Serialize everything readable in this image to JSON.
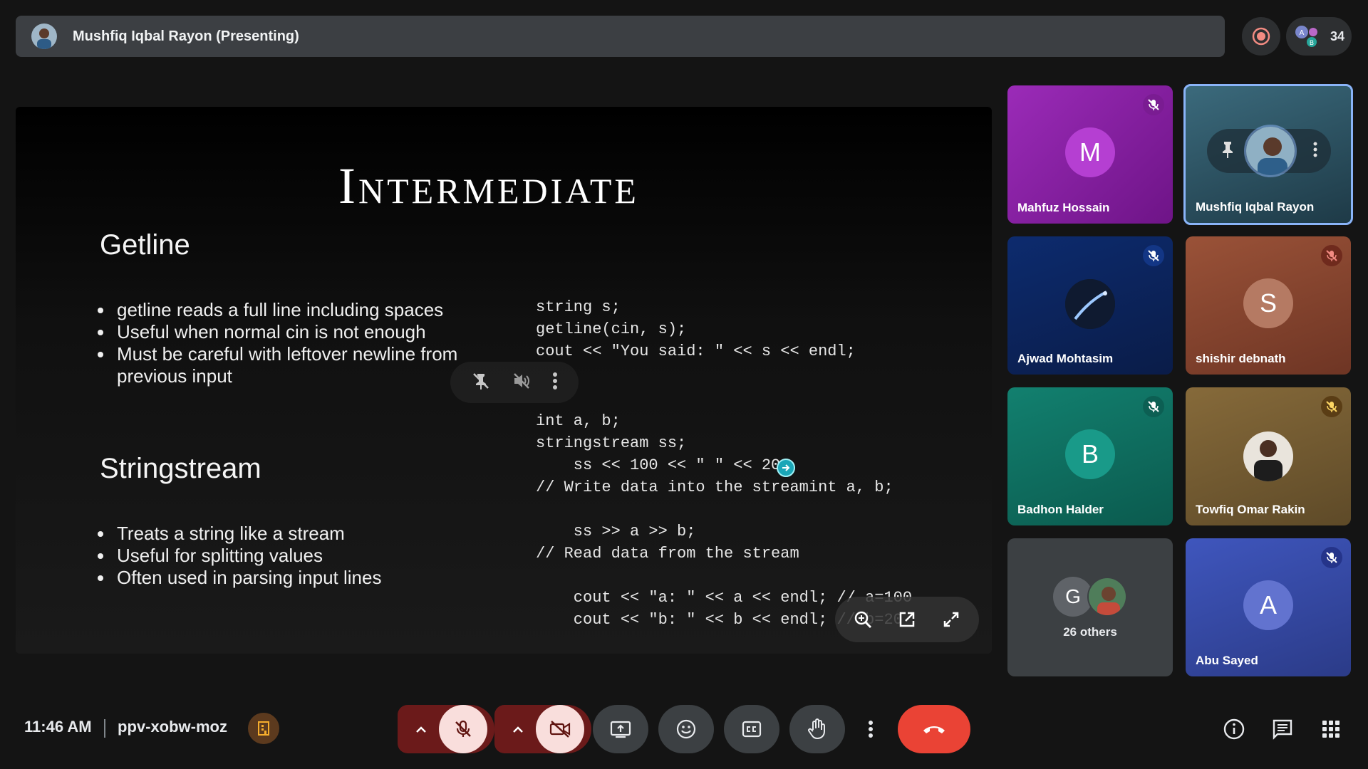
{
  "top_bar": {
    "presenter_title": "Mushfiq Iqbal Rayon (Presenting)",
    "participant_count": "34"
  },
  "slide": {
    "title": "Intermediate",
    "sections": [
      {
        "heading": "Getline",
        "bullets": [
          "getline reads a full line including spaces",
          "Useful when normal cin is not enough",
          "Must be careful with leftover newline from",
          "previous input"
        ],
        "code": "string s;\ngetline(cin, s);\ncout << \"You said: \" << s << endl;"
      },
      {
        "heading": "Stringstream",
        "bullets": [
          "Treats a string like a stream",
          "Useful for splitting values",
          "Often used in parsing input lines"
        ],
        "code": "int a, b;\nstringstream ss;\n    ss << 100 << \" \" << 20;\n// Write data into the streamint a, b;\n\n    ss >> a >> b;\n// Read data from the stream\n\n    cout << \"a: \" << a << endl; // a=100\n    cout << \"b: \" << b << endl; // b=20"
      }
    ]
  },
  "participants": [
    {
      "name": "Mahfuz Hossain",
      "initial": "M",
      "bg": "#8a1fa8",
      "avatar_bg": "#b53fd2",
      "muted": true
    },
    {
      "name": "Mushfiq Iqbal Rayon",
      "initial": "",
      "bg": "#2f5a6b",
      "muted": false,
      "active": true
    },
    {
      "name": "Ajwad Mohtasim",
      "initial": "",
      "bg": "#102a66",
      "muted": true
    },
    {
      "name": "shishir debnath",
      "initial": "S",
      "bg": "#8c4a33",
      "avatar_bg": "#b57a63",
      "muted": true
    },
    {
      "name": "Badhon Halder",
      "initial": "B",
      "bg": "#0f6e61",
      "avatar_bg": "#199a89",
      "muted": true
    },
    {
      "name": "Towfiq Omar Rakin",
      "initial": "",
      "bg": "#7a6236",
      "muted": true
    },
    {
      "name": "26 others",
      "initial": "G",
      "bg": "#3c4043",
      "avatar_bg": "#5f6368",
      "muted": false
    },
    {
      "name": "Abu Sayed",
      "initial": "A",
      "bg": "#3a4fb0",
      "avatar_bg": "#6273cf",
      "muted": true
    }
  ],
  "bottom_bar": {
    "time": "11:46 AM",
    "meeting_code": "ppv-xobw-moz"
  },
  "colors": {
    "end_call": "#ea4335",
    "active_tile_border": "#8ab4f8"
  }
}
